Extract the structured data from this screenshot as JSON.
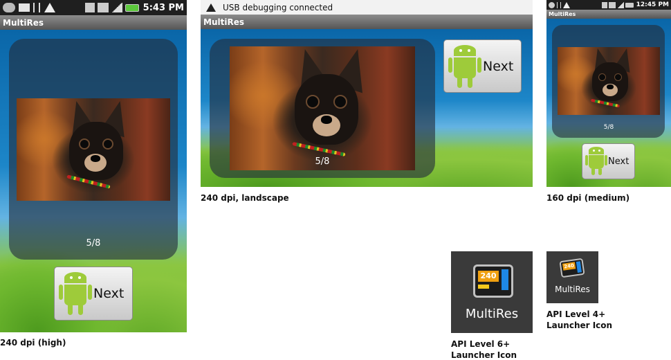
{
  "phone_high": {
    "status_time": "5:43 PM",
    "status_icons": [
      "talk-icon",
      "gmail-icon",
      "usb-icon",
      "warning-icon",
      "vibrate-icon",
      "3g-icon",
      "signal-icon",
      "battery-icon"
    ],
    "app_title": "MultiRes",
    "counter": "5/8",
    "next_label": "Next",
    "caption": "240 dpi (high)"
  },
  "phone_landscape": {
    "notification": "USB debugging connected",
    "app_title": "MultiRes",
    "counter": "5/8",
    "next_label": "Next",
    "caption": "240 dpi, landscape"
  },
  "phone_medium": {
    "status_time": "12:45 PM",
    "app_title": "MultiRes",
    "counter": "5/8",
    "next_label": "Next",
    "caption": "160 dpi (medium)"
  },
  "launcher_api6": {
    "badge": "240",
    "label": "MultiRes",
    "caption_line1": "API Level 6+",
    "caption_line2": "Launcher Icon"
  },
  "launcher_api4": {
    "badge": "240",
    "label": "MultiRes",
    "caption_line1": "API Level 4+",
    "caption_line2": "Launcher Icon"
  },
  "colors": {
    "android_green": "#9ecb3a",
    "badge_orange": "#f0a010",
    "badge_blue": "#1e88e5",
    "status_bar": "#1f1f1f"
  }
}
